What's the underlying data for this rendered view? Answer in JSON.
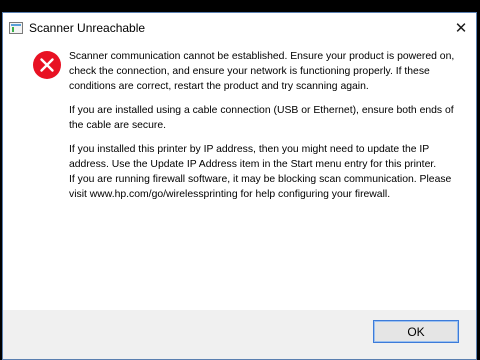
{
  "window": {
    "title": "Scanner Unreachable",
    "close_glyph": "✕"
  },
  "message": {
    "icon": "error-icon",
    "paragraphs": [
      "Scanner communication cannot be established.  Ensure your product is powered on, check the connection, and ensure your network is functioning properly.  If these conditions are correct, restart the product and try scanning again.",
      "If you are installed using a cable connection (USB or Ethernet), ensure both ends of the cable are secure.",
      "If you installed this printer by IP address, then you might need to update the IP address.  Use the Update IP Address item in the Start menu entry for this printer.",
      "If you are running firewall software, it may be blocking scan communication.  Please visit www.hp.com/go/wirelessprinting for help configuring your firewall."
    ]
  },
  "buttons": {
    "ok_label": "OK"
  },
  "colors": {
    "error_red": "#e81123",
    "focus_border": "#3d7bd9",
    "footer_bg": "#f0f0f0"
  }
}
